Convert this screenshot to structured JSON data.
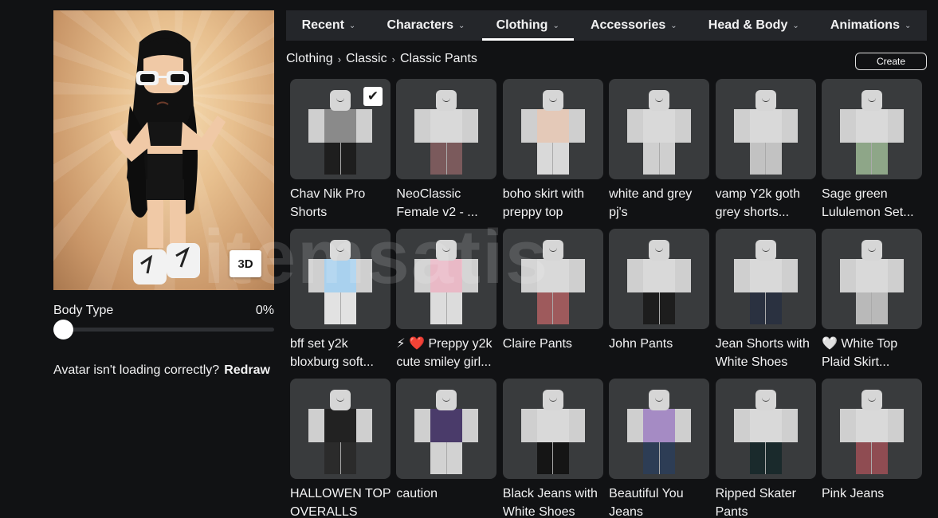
{
  "left": {
    "view_mode_label": "3D",
    "body_type_label": "Body Type",
    "body_type_value": "0%",
    "body_type_fraction": 0,
    "redraw_prompt": "Avatar isn't loading correctly?",
    "redraw_link": "Redraw"
  },
  "tabs": [
    {
      "label": "Recent",
      "active": false
    },
    {
      "label": "Characters",
      "active": false
    },
    {
      "label": "Clothing",
      "active": true
    },
    {
      "label": "Accessories",
      "active": false
    },
    {
      "label": "Head & Body",
      "active": false
    },
    {
      "label": "Animations",
      "active": false
    }
  ],
  "breadcrumb": [
    "Clothing",
    "Classic",
    "Classic Pants"
  ],
  "create_label": "Create",
  "watermark": "itemsatis",
  "items": [
    {
      "name": "Chav Nik Pro Shorts",
      "selected": true,
      "torso": "#8a8a8a",
      "pants": "#1e1e1e"
    },
    {
      "name": "NeoClassic Female v2 - ...",
      "selected": false,
      "torso": "#d9d9d9",
      "pants": "#7b5a5c"
    },
    {
      "name": "boho skirt with preppy top",
      "selected": false,
      "torso": "#e4c9b8",
      "pants": "#d9d9d9"
    },
    {
      "name": "white and grey pj's",
      "selected": false,
      "torso": "#d9d9d9",
      "pants": "#cfcfcf"
    },
    {
      "name": "vamp Y2k goth grey shorts...",
      "selected": false,
      "torso": "#d9d9d9",
      "pants": "#c2c2c2"
    },
    {
      "name": "Sage green Lululemon Set...",
      "selected": false,
      "torso": "#d9d9d9",
      "pants": "#8ea688"
    },
    {
      "name": "bff set y2k bloxburg soft...",
      "selected": false,
      "torso": "#a9d1ee",
      "pants": "#e2e2e2"
    },
    {
      "name": "⚡ ❤️ Preppy y2k cute smiley girl...",
      "selected": false,
      "torso": "#e9b9c6",
      "pants": "#dcdcdc"
    },
    {
      "name": "Claire Pants",
      "selected": false,
      "torso": "#d9d9d9",
      "pants": "#9e5a5c"
    },
    {
      "name": "John Pants",
      "selected": false,
      "torso": "#d9d9d9",
      "pants": "#1d1d1d"
    },
    {
      "name": "Jean Shorts with White Shoes",
      "selected": false,
      "torso": "#d9d9d9",
      "pants": "#2a3140"
    },
    {
      "name": "🤍 White Top Plaid Skirt...",
      "selected": false,
      "torso": "#d9d9d9",
      "pants": "#b9b9b9"
    },
    {
      "name": "HALLOWEN TOP OVERALLS",
      "selected": false,
      "torso": "#222222",
      "pants": "#2b2b2b"
    },
    {
      "name": "caution",
      "selected": false,
      "torso": "#4a3b6a",
      "pants": "#d2d2d2"
    },
    {
      "name": "Black Jeans with White Shoes",
      "selected": false,
      "torso": "#d9d9d9",
      "pants": "#151515"
    },
    {
      "name": "Beautiful You Jeans",
      "selected": false,
      "torso": "#a58bc4",
      "pants": "#2d3d55"
    },
    {
      "name": "Ripped Skater Pants",
      "selected": false,
      "torso": "#d9d9d9",
      "pants": "#1a2a2c"
    },
    {
      "name": "Pink Jeans",
      "selected": false,
      "torso": "#d9d9d9",
      "pants": "#8f4c52"
    }
  ]
}
